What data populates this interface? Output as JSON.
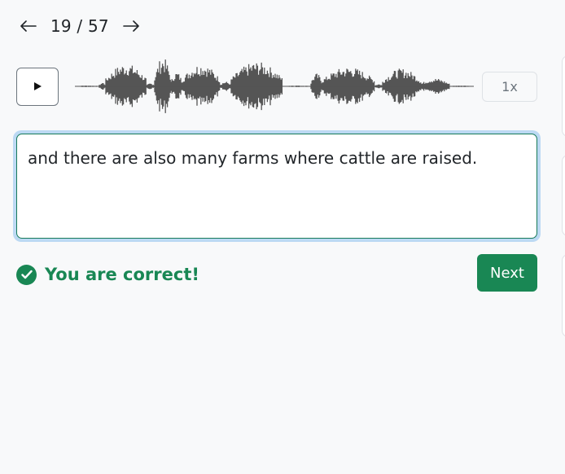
{
  "pager": {
    "prev_icon": "arrow-left-icon",
    "current": "19",
    "separator": "/",
    "total": "57",
    "next_icon": "arrow-right-icon"
  },
  "audio": {
    "play_icon": "play-icon",
    "speed": "1x"
  },
  "answer": {
    "value": "and there are also many farms where cattle are raised."
  },
  "result": {
    "icon": "check-circle-icon",
    "message": "You are correct!"
  },
  "actions": {
    "next_label": "Next"
  },
  "colors": {
    "success": "#198754",
    "focus_ring": "#bcd9f3",
    "waveform": "#555555"
  }
}
